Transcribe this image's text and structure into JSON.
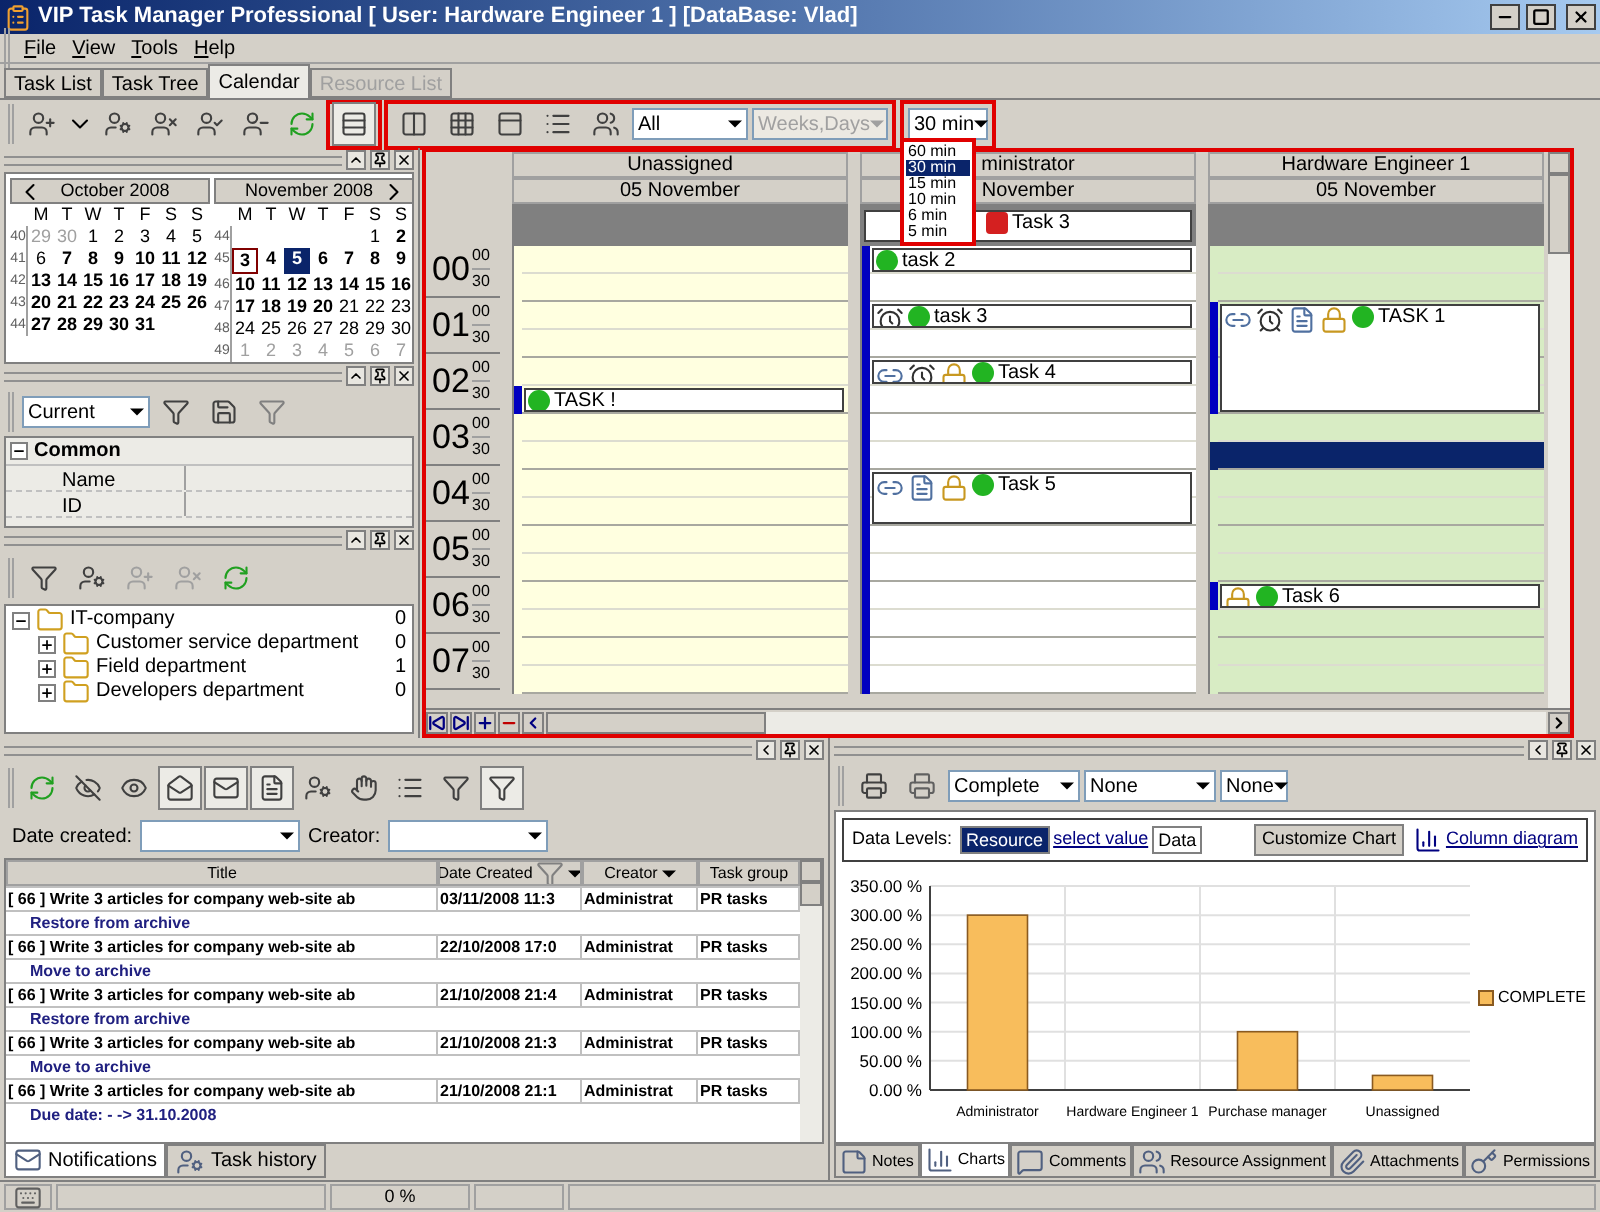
{
  "window": {
    "title": "VIP Task Manager Professional [ User: Hardware Engineer 1 ] [DataBase: Vlad]"
  },
  "menu": [
    "File",
    "View",
    "Tools",
    "Help"
  ],
  "tabs": [
    {
      "label": "Task List",
      "selected": false,
      "disabled": false
    },
    {
      "label": "Task Tree",
      "selected": false,
      "disabled": false
    },
    {
      "label": "Calendar",
      "selected": true,
      "disabled": false
    },
    {
      "label": "Resource List",
      "selected": false,
      "disabled": true
    }
  ],
  "toolbar": {
    "view_buttons": [
      {
        "selected": true
      },
      {
        "selected": false
      },
      {
        "selected": false
      },
      {
        "selected": false
      },
      {
        "selected": false
      }
    ],
    "resource_filter": "All",
    "view_mode": {
      "value": "Weeks,Days",
      "disabled": true
    },
    "scale": {
      "value": "30 min",
      "expanded": true,
      "options": [
        {
          "label": "60 min",
          "selected": false
        },
        {
          "label": "30 min",
          "selected": true
        },
        {
          "label": "15 min",
          "selected": false
        },
        {
          "label": "10 min",
          "selected": false
        },
        {
          "label": "6 min",
          "selected": false
        },
        {
          "label": "5 min",
          "selected": false
        }
      ]
    }
  },
  "mini_calendar": {
    "months": [
      {
        "title": "October 2008",
        "weekdays": [
          "M",
          "T",
          "W",
          "T",
          "F",
          "S",
          "S"
        ],
        "weeks": [
          {
            "number": "40",
            "days": [
              {
                "text": "29",
                "kind": "muted"
              },
              {
                "text": "30",
                "kind": "muted"
              },
              {
                "text": "1",
                "kind": "normal"
              },
              {
                "text": "2",
                "kind": "normal"
              },
              {
                "text": "3",
                "kind": "normal"
              },
              {
                "text": "4",
                "kind": "normal"
              },
              {
                "text": "5",
                "kind": "normal"
              }
            ]
          },
          {
            "number": "41",
            "days": [
              {
                "text": "6",
                "kind": "normal"
              },
              {
                "text": "7",
                "kind": "bold"
              },
              {
                "text": "8",
                "kind": "bold"
              },
              {
                "text": "9",
                "kind": "bold"
              },
              {
                "text": "10",
                "kind": "bold"
              },
              {
                "text": "11",
                "kind": "bold"
              },
              {
                "text": "12",
                "kind": "bold"
              }
            ]
          },
          {
            "number": "42",
            "days": [
              {
                "text": "13",
                "kind": "bold"
              },
              {
                "text": "14",
                "kind": "bold"
              },
              {
                "text": "15",
                "kind": "bold"
              },
              {
                "text": "16",
                "kind": "bold"
              },
              {
                "text": "17",
                "kind": "bold"
              },
              {
                "text": "18",
                "kind": "bold"
              },
              {
                "text": "19",
                "kind": "bold"
              }
            ]
          },
          {
            "number": "43",
            "days": [
              {
                "text": "20",
                "kind": "bold"
              },
              {
                "text": "21",
                "kind": "bold"
              },
              {
                "text": "22",
                "kind": "bold"
              },
              {
                "text": "23",
                "kind": "bold"
              },
              {
                "text": "24",
                "kind": "bold"
              },
              {
                "text": "25",
                "kind": "bold"
              },
              {
                "text": "26",
                "kind": "bold"
              }
            ]
          },
          {
            "number": "44",
            "days": [
              {
                "text": "27",
                "kind": "bold"
              },
              {
                "text": "28",
                "kind": "bold"
              },
              {
                "text": "29",
                "kind": "bold"
              },
              {
                "text": "30",
                "kind": "bold"
              },
              {
                "text": "31",
                "kind": "bold"
              }
            ]
          }
        ]
      },
      {
        "title": "November 2008",
        "weekdays": [
          "M",
          "T",
          "W",
          "T",
          "F",
          "S",
          "S"
        ],
        "weeks": [
          {
            "number": "44",
            "days": [
              {
                "text": "1",
                "kind": "normal"
              },
              {
                "text": "2",
                "kind": "bold"
              }
            ]
          },
          {
            "number": "45",
            "days": [
              {
                "text": "3",
                "kind": "today"
              },
              {
                "text": "4",
                "kind": "bold"
              },
              {
                "text": "5",
                "kind": "selected"
              },
              {
                "text": "6",
                "kind": "bold"
              },
              {
                "text": "7",
                "kind": "bold"
              },
              {
                "text": "8",
                "kind": "bold"
              },
              {
                "text": "9",
                "kind": "bold"
              }
            ]
          },
          {
            "number": "46",
            "days": [
              {
                "text": "10",
                "kind": "bold"
              },
              {
                "text": "11",
                "kind": "bold"
              },
              {
                "text": "12",
                "kind": "bold"
              },
              {
                "text": "13",
                "kind": "bold"
              },
              {
                "text": "14",
                "kind": "bold"
              },
              {
                "text": "15",
                "kind": "bold"
              },
              {
                "text": "16",
                "kind": "bold"
              }
            ]
          },
          {
            "number": "47",
            "days": [
              {
                "text": "17",
                "kind": "bold"
              },
              {
                "text": "18",
                "kind": "bold"
              },
              {
                "text": "19",
                "kind": "bold"
              },
              {
                "text": "20",
                "kind": "bold"
              },
              {
                "text": "21",
                "kind": "normal"
              },
              {
                "text": "22",
                "kind": "normal"
              },
              {
                "text": "23",
                "kind": "normal"
              }
            ]
          },
          {
            "number": "48",
            "days": [
              {
                "text": "24",
                "kind": "normal"
              },
              {
                "text": "25",
                "kind": "normal"
              },
              {
                "text": "26",
                "kind": "normal"
              },
              {
                "text": "27",
                "kind": "normal"
              },
              {
                "text": "28",
                "kind": "normal"
              },
              {
                "text": "29",
                "kind": "normal"
              },
              {
                "text": "30",
                "kind": "normal"
              }
            ]
          },
          {
            "number": "49",
            "days": [
              {
                "text": "1",
                "kind": "muted"
              },
              {
                "text": "2",
                "kind": "muted"
              },
              {
                "text": "3",
                "kind": "muted"
              },
              {
                "text": "4",
                "kind": "muted"
              },
              {
                "text": "5",
                "kind": "muted"
              },
              {
                "text": "6",
                "kind": "muted"
              },
              {
                "text": "7",
                "kind": "muted"
              }
            ]
          }
        ]
      }
    ]
  },
  "properties": {
    "filter": "Current",
    "group": {
      "label": "Common",
      "expanded": true,
      "rows": [
        "Name",
        "ID"
      ]
    }
  },
  "org_tree": [
    {
      "label": "IT-company",
      "count": "0",
      "expanded": true,
      "children": [
        {
          "label": "Customer service department",
          "count": "0",
          "expanded": false
        },
        {
          "label": "Field department",
          "count": "1",
          "expanded": false
        },
        {
          "label": "Developers department",
          "count": "0",
          "expanded": false
        }
      ]
    }
  ],
  "calendar": {
    "time_slots": [
      {
        "hour": "00",
        "minutes": [
          "00",
          "30"
        ]
      },
      {
        "hour": "01",
        "minutes": [
          "00",
          "30"
        ]
      },
      {
        "hour": "02",
        "minutes": [
          "00",
          "30"
        ]
      },
      {
        "hour": "03",
        "minutes": [
          "00",
          "30"
        ]
      },
      {
        "hour": "04",
        "minutes": [
          "00",
          "30"
        ]
      },
      {
        "hour": "05",
        "minutes": [
          "00",
          "30"
        ]
      },
      {
        "hour": "06",
        "minutes": [
          "00",
          "30"
        ]
      },
      {
        "hour": "07",
        "minutes": [
          "00",
          "30"
        ]
      }
    ],
    "columns": [
      {
        "name": "Unassigned",
        "date": "05 November",
        "color": "#ffffe0",
        "slots": [
          {
            "busy": false,
            "selected": false
          },
          {
            "busy": false,
            "selected": false
          },
          {
            "busy": false,
            "selected": false
          },
          {
            "busy": false,
            "selected": false
          },
          {
            "busy": false,
            "selected": false
          },
          {
            "busy": true,
            "selected": false,
            "event": {
              "title": "TASK !",
              "kind": "short",
              "color": "#22b422"
            }
          },
          {
            "busy": false,
            "selected": false
          },
          {
            "busy": false,
            "selected": false
          },
          {
            "busy": false,
            "selected": false
          },
          {
            "busy": false,
            "selected": false
          },
          {
            "busy": false,
            "selected": false
          },
          {
            "busy": false,
            "selected": false
          },
          {
            "busy": false,
            "selected": false
          },
          {
            "busy": false,
            "selected": false
          },
          {
            "busy": false,
            "selected": false
          },
          {
            "busy": false,
            "selected": false
          }
        ]
      },
      {
        "name": "ministrator",
        "date": "November",
        "color": "#ffffff",
        "all_day_events": [
          {
            "title": "Task 3",
            "color": "#d42020"
          }
        ],
        "slots": [
          {
            "busy": true,
            "selected": false,
            "event": {
              "title": "task 2",
              "kind": "short",
              "color": "#22b422"
            }
          },
          {
            "busy": true,
            "selected": false
          },
          {
            "busy": true,
            "selected": false,
            "event": {
              "title": "task 3",
              "kind": "short",
              "color": "#22b422",
              "reminder": true
            }
          },
          {
            "busy": true,
            "selected": false
          },
          {
            "busy": true,
            "selected": false,
            "event": {
              "title": "Task 4",
              "kind": "short",
              "color": "#22b422",
              "linked": true,
              "reminder": true,
              "locked": true
            }
          },
          {
            "busy": true,
            "selected": false
          },
          {
            "busy": true,
            "selected": false
          },
          {
            "busy": true,
            "selected": false
          },
          {
            "busy": true,
            "selected": false,
            "event": {
              "title": "Task 5",
              "kind": "medium",
              "color": "#22b422",
              "linked": true,
              "locked": true,
              "attached": true
            }
          },
          {
            "busy": true,
            "selected": false
          },
          {
            "busy": true,
            "selected": false
          },
          {
            "busy": true,
            "selected": false
          },
          {
            "busy": true,
            "selected": false
          },
          {
            "busy": true,
            "selected": false
          },
          {
            "busy": true,
            "selected": false
          },
          {
            "busy": true,
            "selected": false
          }
        ]
      },
      {
        "name": "Hardware Engineer 1",
        "date": "05 November",
        "color": "#d8ecc4",
        "slots": [
          {
            "busy": false,
            "selected": false
          },
          {
            "busy": false,
            "selected": false
          },
          {
            "busy": true,
            "selected": false,
            "event": {
              "title": "TASK 1",
              "kind": "long",
              "color": "#22b422",
              "linked": true,
              "reminder": true,
              "locked": true,
              "attached": true
            }
          },
          {
            "busy": true,
            "selected": false
          },
          {
            "busy": true,
            "selected": false
          },
          {
            "busy": true,
            "selected": false
          },
          {
            "busy": false,
            "selected": false
          },
          {
            "busy": false,
            "selected": true
          },
          {
            "busy": false,
            "selected": false
          },
          {
            "busy": false,
            "selected": false
          },
          {
            "busy": false,
            "selected": false
          },
          {
            "busy": false,
            "selected": false
          },
          {
            "busy": true,
            "selected": false,
            "event": {
              "title": "Task 6",
              "kind": "short",
              "color": "#22b422",
              "locked": true
            }
          },
          {
            "busy": false,
            "selected": false
          },
          {
            "busy": false,
            "selected": false
          },
          {
            "busy": false,
            "selected": false
          }
        ]
      }
    ]
  },
  "history": {
    "filters": [
      {
        "label": "Date created:"
      },
      {
        "label": "Creator:"
      }
    ],
    "columns": [
      {
        "label": "Title",
        "filter": false,
        "menu": false
      },
      {
        "label": "Date Created",
        "filter": true,
        "menu": true
      },
      {
        "label": "Creator",
        "filter": false,
        "menu": true
      },
      {
        "label": "Task group",
        "filter": false,
        "menu": false
      }
    ],
    "rows": [
      {
        "title": "[ 66 ] Write 3 articles for company web-site ab",
        "date": "03/11/2008 11:3",
        "creator": "Administrat",
        "group": "PR tasks",
        "detail": "Restore from archive"
      },
      {
        "title": "[ 66 ] Write 3 articles for company web-site ab",
        "date": "22/10/2008 17:0",
        "creator": "Administrat",
        "group": "PR tasks",
        "detail": "Move to archive"
      },
      {
        "title": "[ 66 ] Write 3 articles for company web-site ab",
        "date": "21/10/2008 21:4",
        "creator": "Administrat",
        "group": "PR tasks",
        "detail": "Restore from archive"
      },
      {
        "title": "[ 66 ] Write 3 articles for company web-site ab",
        "date": "21/10/2008 21:3",
        "creator": "Administrat",
        "group": "PR tasks",
        "detail": "Move to archive"
      },
      {
        "title": "[ 66 ] Write 3 articles for company web-site ab",
        "date": "21/10/2008 21:1",
        "creator": "Administrat",
        "group": "PR tasks",
        "detail": "Due date: - -> 31.10.2008"
      }
    ],
    "tabs": [
      {
        "label": "Notifications",
        "selected": true
      },
      {
        "label": "Task history",
        "selected": false
      }
    ]
  },
  "chart_panel": {
    "selectors": [
      "Complete",
      "None",
      "None"
    ],
    "data_levels_label": "Data Levels:",
    "levels": [
      {
        "label": "Resource",
        "kind": "chip",
        "selected": true
      },
      {
        "label": "select value",
        "kind": "link"
      },
      {
        "label": "Data",
        "kind": "chip",
        "selected": false
      }
    ],
    "customize_button": "Customize Chart",
    "diagram_link": "Column diagram",
    "chart_data": {
      "type": "bar",
      "categories": [
        "Administrator",
        "Hardware Engineer 1",
        "Purchase manager",
        "Unassigned"
      ],
      "series": [
        {
          "name": "COMPLETE",
          "color": "#f8bd5c",
          "values": [
            300,
            0,
            100,
            25
          ]
        }
      ],
      "ylim": [
        0,
        350
      ],
      "grid": true,
      "yticks": [
        {
          "value": 0,
          "label": "0.00 %"
        },
        {
          "value": 50,
          "label": "50.00 %"
        },
        {
          "value": 100,
          "label": "100.00 %"
        },
        {
          "value": 150,
          "label": "150.00 %"
        },
        {
          "value": 200,
          "label": "200.00 %"
        },
        {
          "value": 250,
          "label": "250.00 %"
        },
        {
          "value": 300,
          "label": "300.00 %"
        },
        {
          "value": 350,
          "label": "350.00 %"
        }
      ]
    },
    "tabs": [
      {
        "label": "Notes",
        "selected": false
      },
      {
        "label": "Charts",
        "selected": true
      },
      {
        "label": "Comments",
        "selected": false
      },
      {
        "label": "Resource Assignment",
        "selected": false
      },
      {
        "label": "Attachments",
        "selected": false
      },
      {
        "label": "Permissions",
        "selected": false
      }
    ]
  },
  "status_bar": {
    "progress": "0 %"
  }
}
